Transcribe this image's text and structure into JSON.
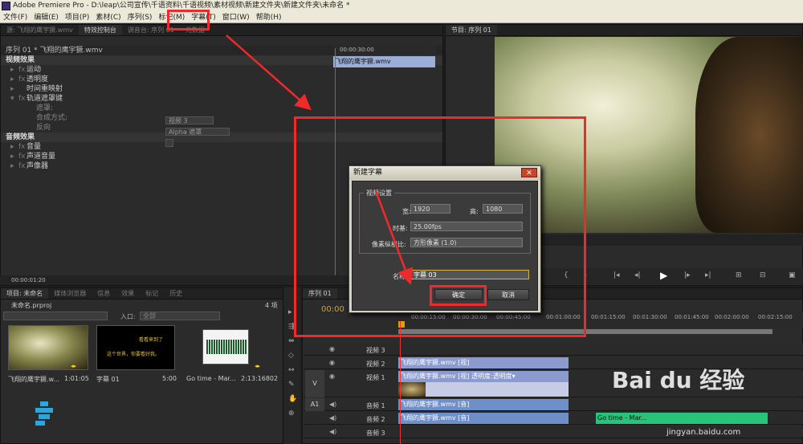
{
  "window": {
    "title": "Adobe Premiere Pro - D:\\leap\\公司宣传\\千语资料\\千语视频\\素材视频\\新建文件夹\\新建文件夹\\未命名 *"
  },
  "menu": [
    "文件(F)",
    "编辑(E)",
    "项目(P)",
    "素材(C)",
    "序列(S)",
    "标记(M)",
    "字幕(T)",
    "窗口(W)",
    "帮助(H)"
  ],
  "effect_controls": {
    "tabs": [
      "源: 飞翔的鹰宇獗.wmv",
      "特效控制台",
      "调音台: 序列 01",
      "元数据"
    ],
    "sequence_label": "序列 01 * 飞翔的鹰宇獗.wmv",
    "clip_label": "飞翔的鹰宇獗.wmv",
    "video_effects": "视频效果",
    "motion": "运动",
    "opacity": "透明度",
    "time_remap": "时间重映射",
    "track_matte": "轨道遮罩键",
    "matte_label": "遮罩:",
    "matte_value": "视频 3",
    "composite_label": "合成方式:",
    "composite_value": "Alpha 遮罩",
    "reverse_label": "反向",
    "audio_effects": "音频效果",
    "volume": "音量",
    "channel_volume": "声道音量",
    "panner": "声像器",
    "timecode_top": "00:00:30:00",
    "timecode_bottom": "00:00:01:20"
  },
  "program": {
    "tab": "节目: 序列 01"
  },
  "project": {
    "tabs": [
      "项目: 未命名",
      "媒体浏览器",
      "信息",
      "效果",
      "标记",
      "历史"
    ],
    "name": "未命名.prproj",
    "count": "4 项",
    "entry_label": "入口:",
    "entry_value": "全部",
    "items": [
      {
        "name": "飞翔的鹰宇獗.w...",
        "duration": "1:01:05"
      },
      {
        "name": "字幕 01",
        "duration": "5:00"
      },
      {
        "name": "Go time - Mar...",
        "duration": "2:13:16802"
      }
    ],
    "title_thumb_text": "这个世界，你要看好我。",
    "title_thumb_text2": "看看来到了"
  },
  "timeline": {
    "tab": "序列 01",
    "timecode": "00:00",
    "ruler": [
      "00:00:15:00",
      "00:00:30:00",
      "00:00:45:00",
      "00:01:00:00",
      "00:01:15:00",
      "00:01:30:00",
      "00:01:45:00",
      "00:02:00:00",
      "00:02:15:00"
    ],
    "tracks": [
      {
        "name": "视频 3"
      },
      {
        "name": "视频 2",
        "clip": "飞翔的鹰宇獗.wmv [视]"
      },
      {
        "name": "视频 1",
        "clip": "飞翔的鹰宇獗.wmv [视] 透明度:透明度▾"
      },
      {
        "name": "音频 1",
        "clip": "飞翔的鹰宇獗.wmv [音]"
      },
      {
        "name": "音频 2",
        "clip": "飞翔的鹰宇獗.wmv [音]",
        "clip2": "Go time - Mar..."
      },
      {
        "name": "音频 3"
      }
    ],
    "side_v": "V",
    "side_a1": "A1"
  },
  "dialog": {
    "title": "新建字幕",
    "group": "视频设置",
    "width_label": "宽:",
    "width_value": "1920",
    "height_label": "高:",
    "height_value": "1080",
    "timebase_label": "时基:",
    "timebase_value": "25.00fps",
    "par_label": "像素纵横比:",
    "par_value": "方形像素 (1.0)",
    "name_label": "名称:",
    "name_value": "字幕 03",
    "ok": "确定",
    "cancel": "取消"
  },
  "watermark": {
    "brand": "Bai du 经验",
    "url": "jingyan.baidu.com"
  },
  "colors": {
    "accent_red": "#f02a2a",
    "clip_video": "#7a8fc7",
    "clip_audio": "#6f8fc9",
    "clip_green": "#27c47a"
  }
}
